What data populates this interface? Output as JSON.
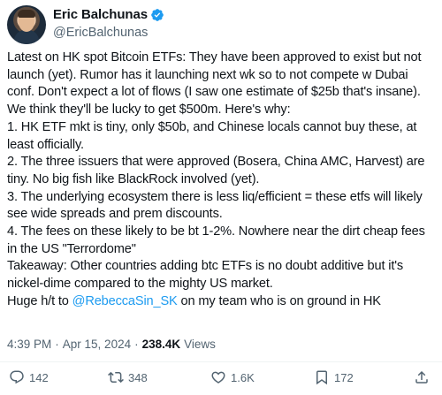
{
  "author": {
    "display_name": "Eric Balchunas",
    "handle": "@EricBalchunas",
    "verified": true
  },
  "tweet": {
    "text_before_mention": "Latest on HK spot Bitcoin ETFs: They have been approved to exist but not launch (yet). Rumor has it launching next wk so to not compete w Dubai conf. Don't expect a lot of flows (I saw one estimate of $25b that's insane). We think they'll be lucky to get $500m. Here's why:\n1. HK ETF mkt is tiny, only $50b, and Chinese locals cannot buy these, at least officially.\n2. The three issuers that were approved (Bosera, China AMC, Harvest) are tiny. No big fish like BlackRock involved (yet).\n3. The underlying ecosystem there is less liq/efficient = these etfs will likely see wide spreads and prem discounts.\n4. The fees on these likely to be bt 1-2%. Nowhere near the dirt cheap fees in the US \"Terrordome\"\nTakeaway: Other countries adding btc ETFs is no doubt additive but it's nickel-dime compared to the mighty US market.\nHuge h/t to ",
    "mention": "@RebeccaSin_SK",
    "text_after_mention": " on my team who is on ground in HK"
  },
  "meta": {
    "time": "4:39 PM",
    "separator": "·",
    "date": "Apr 15, 2024",
    "views_count": "238.4K",
    "views_label": "Views"
  },
  "actions": {
    "replies": "142",
    "reposts": "348",
    "likes": "1.6K",
    "bookmarks": "172"
  },
  "colors": {
    "accent": "#1d9bf0",
    "secondary_text": "#536471",
    "primary_text": "#0f1419"
  },
  "icons": [
    "verified-badge-icon",
    "reply-icon",
    "repost-icon",
    "like-icon",
    "bookmark-icon",
    "share-icon"
  ]
}
